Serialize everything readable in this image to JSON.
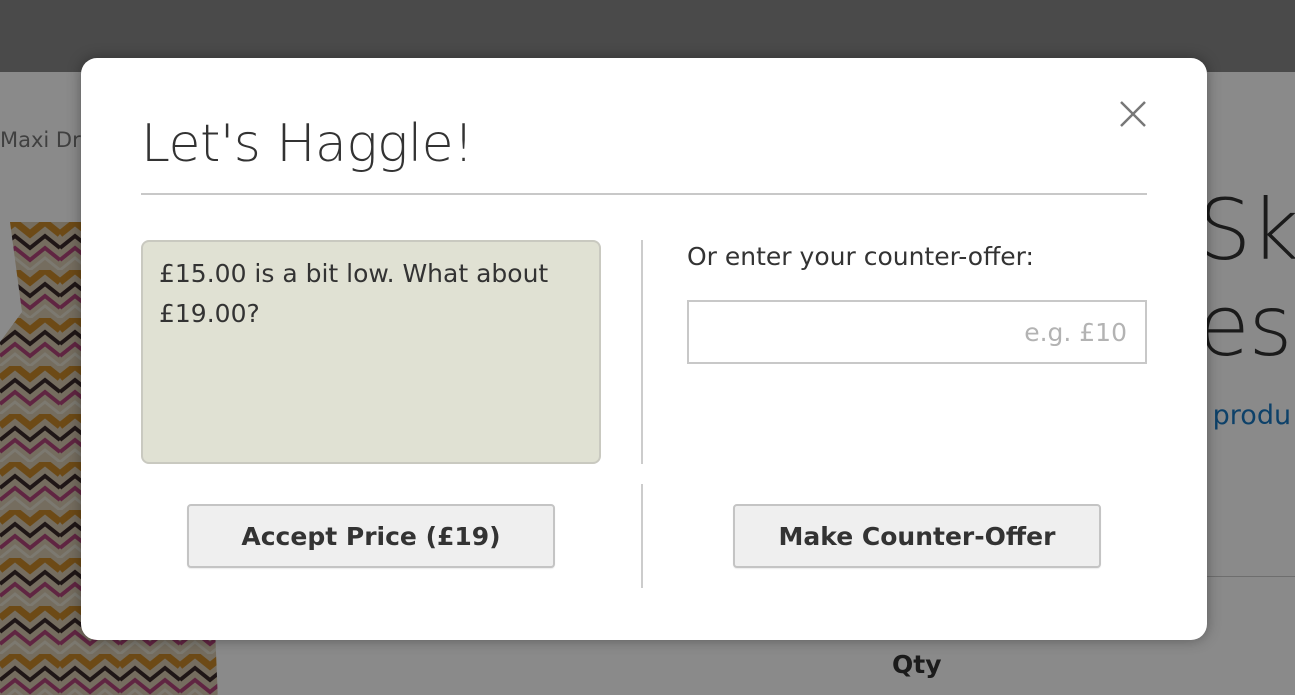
{
  "background_page": {
    "breadcrumb": "Maxi Dre",
    "title_line1": "Sky",
    "title_line2": "ess",
    "link_fragment": "s produ",
    "qty_label": "Qty"
  },
  "modal": {
    "title": "Let's Haggle!",
    "close_icon": "close-icon",
    "message": "£15.00 is a bit low. What about £19.00?",
    "counter_label": "Or enter your counter-offer:",
    "counter_input": {
      "value": "",
      "placeholder": "e.g. £10"
    },
    "accept_button": "Accept Price (£19)",
    "counter_button": "Make Counter-Offer"
  },
  "colors": {
    "message_bg": "#e0e1d3",
    "link": "#1979c3",
    "overlay": "rgba(0,0,0,0.46)"
  }
}
